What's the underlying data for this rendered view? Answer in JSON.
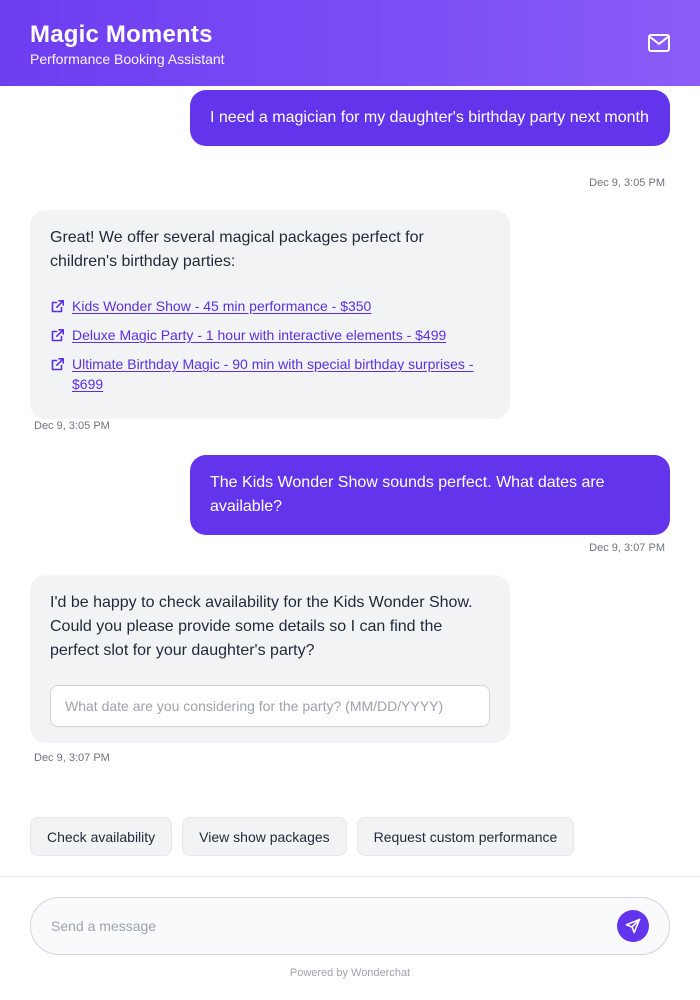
{
  "header": {
    "title": "Magic Moments",
    "subtitle": "Performance Booking Assistant",
    "mail_icon": "mail-icon"
  },
  "messages": [
    {
      "role": "user",
      "text": "I need a magician for my daughter's birthday party next month",
      "timestamp": "Dec 9, 3:05 PM"
    },
    {
      "role": "bot",
      "text": "Great! We offer several magical packages perfect for children's birthday parties:",
      "links": [
        "Kids Wonder Show - 45 min performance - $350",
        "Deluxe Magic Party - 1 hour with interactive elements - $499",
        "Ultimate Birthday Magic - 90 min with special birthday surprises - $699"
      ],
      "link_icon": "external-link-icon",
      "timestamp": "Dec 9, 3:05 PM"
    },
    {
      "role": "user",
      "text": "The Kids Wonder Show sounds perfect. What dates are available?",
      "timestamp": "Dec 9, 3:07 PM"
    },
    {
      "role": "bot",
      "text": "I'd be happy to check availability for the Kids Wonder Show. Could you please provide some details so I can find the perfect slot for your daughter's party?",
      "input_placeholder": "What date are you considering for the party? (MM/DD/YYYY)",
      "input_value": "",
      "timestamp": "Dec 9, 3:07 PM"
    }
  ],
  "quick_replies": [
    "Check availability",
    "View show packages",
    "Request custom performance"
  ],
  "composer": {
    "placeholder": "Send a message",
    "value": "",
    "send_icon": "send-icon"
  },
  "footer": {
    "powered_by": "Powered by Wonderchat"
  },
  "colors": {
    "accent": "#6235ec",
    "header_gradient_start": "#6d3df0",
    "header_gradient_end": "#8b5cf6",
    "bot_bubble": "#f2f3f5",
    "link": "#5b2fe0"
  }
}
